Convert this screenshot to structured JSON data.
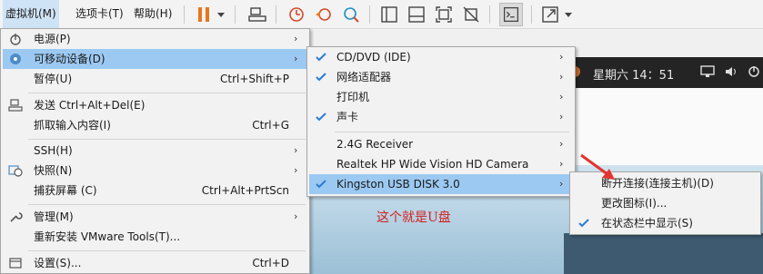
{
  "toolbar": {
    "menus": [
      "虚拟机(M)",
      "选项卡(T)",
      "帮助(H)"
    ]
  },
  "clock": {
    "text": "星期六 14：51"
  },
  "main_menu": {
    "items": [
      {
        "label": "电源(P)",
        "shortcut": "",
        "icon": "power-icon"
      },
      {
        "label": "可移动设备(D)",
        "shortcut": "",
        "icon": "removable-device-icon"
      },
      {
        "label": "暂停(U)",
        "shortcut": "Ctrl+Shift+P",
        "icon": ""
      },
      {
        "label": "发送 Ctrl+Alt+Del(E)",
        "shortcut": "",
        "icon": "send-keys-icon"
      },
      {
        "label": "抓取输入内容(I)",
        "shortcut": "Ctrl+G",
        "icon": ""
      },
      {
        "label": "SSH(H)",
        "shortcut": "",
        "icon": ""
      },
      {
        "label": "快照(N)",
        "shortcut": "",
        "icon": "snapshot-icon"
      },
      {
        "label": "捕获屏幕 (C)",
        "shortcut": "Ctrl+Alt+PrtScn",
        "icon": ""
      },
      {
        "label": "管理(M)",
        "shortcut": "",
        "icon": "wrench-icon"
      },
      {
        "label": "重新安装 VMware Tools(T)...",
        "shortcut": "",
        "icon": ""
      },
      {
        "label": "设置(S)...",
        "shortcut": "Ctrl+D",
        "icon": "settings-icon"
      }
    ]
  },
  "devices_menu": {
    "items": [
      {
        "label": "CD/DVD (IDE)",
        "checked": true
      },
      {
        "label": "网络适配器",
        "checked": true
      },
      {
        "label": "打印机",
        "checked": false
      },
      {
        "label": "声卡",
        "checked": true
      },
      {
        "label": "2.4G Receiver",
        "checked": false
      },
      {
        "label": "Realtek HP Wide Vision HD Camera",
        "checked": false
      },
      {
        "label": "Kingston USB DISK 3.0",
        "checked": true
      }
    ]
  },
  "usb_menu": {
    "items": [
      {
        "label": "断开连接(连接主机)(D)",
        "checked": false
      },
      {
        "label": "更改图标(I)...",
        "checked": false
      },
      {
        "label": "在状态栏中显示(S)",
        "checked": true
      }
    ]
  },
  "annotation": {
    "text": "这个就是U盘"
  },
  "colors": {
    "highlight": "#9cc9f2",
    "check": "#2b7bd6",
    "annotation": "#d32020",
    "pause": "#e8761e"
  }
}
